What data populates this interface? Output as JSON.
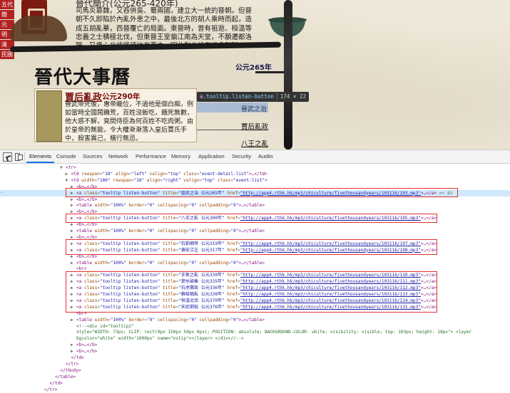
{
  "webpage": {
    "left_nav": [
      "五代",
      "簡",
      "元",
      "明",
      "清",
      "民國"
    ],
    "intro": {
      "title": "晉代簡介(公元265-420年)",
      "text": "司馬炎篡魏，又吞併吳、蜀兩國，建立大一統的晉朝。但晉朝不久即陷於內亂外患之中，最後北方的胡人乘時而起，造成五胡亂華，西晉覆亡的局面。東晉時，曾有祖逖、桓溫等忠義之士積極北伐，但東晉王室偏江南為天堂，不願遷都洛陽，又擔心北伐將領功高蓋主，因此對北伐者諸多掣肘。"
    },
    "section_title": "晉代大事曆",
    "year_marker": "公元265年",
    "event": {
      "title": "賈后亂政",
      "year": "公元290年",
      "description": "晉武帝死後，惠帝繼位，不過他是個白痴，例如當時全國鬧饑荒，百姓沒飯吃，餓死無數，他大惑不解，竟問侍臣為何百姓不吃肉粥。由於皇帝的無能，令大權漸漸落入皇后賈氏手中，殺害異己，橫行無忌。"
    },
    "tooltip_hint": {
      "tag": "a",
      "cls": ".tooltip.listen-button",
      "size": "174 × 22"
    },
    "links": [
      "晉武之治",
      "賈后亂政",
      "八王之亂"
    ]
  },
  "devtools": {
    "tabs": [
      "Elements",
      "Console",
      "Sources",
      "Network",
      "Performance",
      "Memory",
      "Application",
      "Security",
      "Audits"
    ],
    "active_tab": "Elements",
    "dom_rows": [
      {
        "indent": 0,
        "tri": "▼",
        "parts": [
          [
            "t",
            "<tr>"
          ]
        ]
      },
      {
        "indent": 1,
        "tri": "▶",
        "parts": [
          [
            "t",
            "<td "
          ],
          [
            "an",
            "rowspan"
          ],
          [
            "eq",
            "="
          ],
          [
            "av",
            "\"18\""
          ],
          [
            "an",
            " align"
          ],
          [
            "eq",
            "="
          ],
          [
            "av",
            "\"left\""
          ],
          [
            "an",
            " valign"
          ],
          [
            "eq",
            "="
          ],
          [
            "av",
            "\"top\""
          ],
          [
            "an",
            " class"
          ],
          [
            "eq",
            "="
          ],
          [
            "av",
            "\"event-detail-list\""
          ],
          [
            "t",
            ">…</td>"
          ]
        ]
      },
      {
        "indent": 1,
        "tri": "▼",
        "parts": [
          [
            "t",
            "<td "
          ],
          [
            "an",
            "width"
          ],
          [
            "eq",
            "="
          ],
          [
            "av",
            "\"180\""
          ],
          [
            "an",
            " rowspan"
          ],
          [
            "eq",
            "="
          ],
          [
            "av",
            "\"18\""
          ],
          [
            "an",
            " align"
          ],
          [
            "eq",
            "="
          ],
          [
            "av",
            "\"right\""
          ],
          [
            "an",
            " valign"
          ],
          [
            "eq",
            "="
          ],
          [
            "av",
            "\"top\""
          ],
          [
            "an",
            " class"
          ],
          [
            "eq",
            "="
          ],
          [
            "av",
            "\"event-list\""
          ],
          [
            "t",
            ">"
          ]
        ]
      },
      {
        "indent": 2,
        "tri": "▶",
        "parts": [
          [
            "t",
            "<b>…</b>"
          ]
        ]
      },
      {
        "indent": 2,
        "tri": "▶",
        "sel": true,
        "parts": [
          [
            "t",
            "<a "
          ],
          [
            "an",
            "class"
          ],
          [
            "eq",
            "="
          ],
          [
            "av",
            "\"tooltip listen-button\""
          ],
          [
            "an",
            " title"
          ],
          [
            "eq",
            "="
          ],
          [
            "av",
            "\"晉武之治 公元265年\""
          ],
          [
            "an",
            " href"
          ],
          [
            "eq",
            "="
          ],
          [
            "url",
            "\"http://app4.rthk.hk/mp3/chiculture/fivethousandyears/103116/103.mp3\""
          ],
          [
            "t",
            ">…</a>"
          ],
          [
            "eq",
            " == $0"
          ]
        ]
      },
      {
        "indent": 2,
        "tri": "▶",
        "parts": [
          [
            "t",
            "<b>…</b>"
          ]
        ]
      },
      {
        "indent": 2,
        "tri": "▶",
        "parts": [
          [
            "t",
            "<table "
          ],
          [
            "an",
            "width"
          ],
          [
            "eq",
            "="
          ],
          [
            "av",
            "\"100%\""
          ],
          [
            "an",
            " border"
          ],
          [
            "eq",
            "="
          ],
          [
            "av",
            "\"0\""
          ],
          [
            "an",
            " cellspacing"
          ],
          [
            "eq",
            "="
          ],
          [
            "av",
            "\"0\""
          ],
          [
            "an",
            " cellpadding"
          ],
          [
            "eq",
            "="
          ],
          [
            "av",
            "\"0\""
          ],
          [
            "t",
            ">…</table>"
          ]
        ]
      },
      {
        "indent": 2,
        "tri": "▶",
        "parts": [
          [
            "t",
            "<b>…</b>"
          ]
        ]
      },
      {
        "indent": 2,
        "tri": "▶",
        "parts": [
          [
            "t",
            "<a "
          ],
          [
            "an",
            "class"
          ],
          [
            "eq",
            "="
          ],
          [
            "av",
            "\"tooltip listen-button\""
          ],
          [
            "an",
            " title"
          ],
          [
            "eq",
            "="
          ],
          [
            "av",
            "\"八王之亂 公元300年\""
          ],
          [
            "an",
            " href"
          ],
          [
            "eq",
            "="
          ],
          [
            "url",
            "\"http://app4.rthk.hk/mp3/chiculture/fivethousandyears/103116/105.mp3\""
          ],
          [
            "t",
            ">…</a>"
          ]
        ]
      },
      {
        "indent": 2,
        "tri": "▶",
        "parts": [
          [
            "t",
            "<b>…</b>"
          ]
        ]
      },
      {
        "indent": 2,
        "tri": "▶",
        "parts": [
          [
            "t",
            "<table "
          ],
          [
            "an",
            "width"
          ],
          [
            "eq",
            "="
          ],
          [
            "av",
            "\"100%\""
          ],
          [
            "an",
            " border"
          ],
          [
            "eq",
            "="
          ],
          [
            "av",
            "\"0\""
          ],
          [
            "an",
            " cellspacing"
          ],
          [
            "eq",
            "="
          ],
          [
            "av",
            "\"0\""
          ],
          [
            "an",
            " cellpadding"
          ],
          [
            "eq",
            "="
          ],
          [
            "av",
            "\"0\""
          ],
          [
            "t",
            ">…</table>"
          ]
        ]
      },
      {
        "indent": 2,
        "tri": "▶",
        "parts": [
          [
            "t",
            "<b>…</b>"
          ]
        ]
      },
      {
        "indent": 2,
        "tri": "▶",
        "parts": [
          [
            "t",
            "<a "
          ],
          [
            "an",
            "class"
          ],
          [
            "eq",
            "="
          ],
          [
            "av",
            "\"tooltip listen-button\""
          ],
          [
            "an",
            " title"
          ],
          [
            "eq",
            "="
          ],
          [
            "av",
            "\"石勒稱帝 公元319年\""
          ],
          [
            "an",
            " href"
          ],
          [
            "eq",
            "="
          ],
          [
            "url",
            "\"http://app4.rthk.hk/mp3/chiculture/fivethousandyears/103116/107.mp3\""
          ],
          [
            "t",
            ">…</a>"
          ]
        ]
      },
      {
        "indent": 2,
        "tri": "▶",
        "parts": [
          [
            "t",
            "<a "
          ],
          [
            "an",
            "class"
          ],
          [
            "eq",
            "="
          ],
          [
            "av",
            "\"tooltip listen-button\""
          ],
          [
            "an",
            " title"
          ],
          [
            "eq",
            "="
          ],
          [
            "av",
            "\"偏安江左 公元317年\""
          ],
          [
            "an",
            " href"
          ],
          [
            "eq",
            "="
          ],
          [
            "url",
            "\"http://app4.rthk.hk/mp3/chiculture/fivethousandyears/103116/108.mp3\""
          ],
          [
            "t",
            ">…</a>"
          ]
        ]
      },
      {
        "indent": 2,
        "tri": "▶",
        "parts": [
          [
            "t",
            "<b>…</b>"
          ]
        ]
      },
      {
        "indent": 2,
        "tri": "▶",
        "parts": [
          [
            "t",
            "<table "
          ],
          [
            "an",
            "width"
          ],
          [
            "eq",
            "="
          ],
          [
            "av",
            "\"100%\""
          ],
          [
            "an",
            " border"
          ],
          [
            "eq",
            "="
          ],
          [
            "av",
            "\"0\""
          ],
          [
            "an",
            " cellspacing"
          ],
          [
            "eq",
            "="
          ],
          [
            "av",
            "\"0\""
          ],
          [
            "an",
            " cellpadding"
          ],
          [
            "eq",
            "="
          ],
          [
            "av",
            "\"0\""
          ],
          [
            "t",
            ">…</table>"
          ]
        ]
      },
      {
        "indent": 2,
        "tri": " ",
        "parts": [
          [
            "t",
            "<br>"
          ]
        ]
      },
      {
        "indent": 2,
        "tri": "▶",
        "parts": [
          [
            "t",
            "<a "
          ],
          [
            "an",
            "class"
          ],
          [
            "eq",
            "="
          ],
          [
            "av",
            "\"tooltip listen-button\""
          ],
          [
            "an",
            " title"
          ],
          [
            "eq",
            "="
          ],
          [
            "av",
            "\"王敦之亂 公元330年\""
          ],
          [
            "an",
            " href"
          ],
          [
            "eq",
            "="
          ],
          [
            "url",
            "\"http://app4.rthk.hk/mp3/chiculture/fivethousandyears/103116/110.mp3\""
          ],
          [
            "t",
            ">…</a>"
          ]
        ]
      },
      {
        "indent": 2,
        "tri": "▶",
        "parts": [
          [
            "t",
            "<a "
          ],
          [
            "an",
            "class"
          ],
          [
            "eq",
            "="
          ],
          [
            "av",
            "\"tooltip listen-button\""
          ],
          [
            "an",
            " title"
          ],
          [
            "eq",
            "="
          ],
          [
            "av",
            "\"淝水破秦 公元335年\""
          ],
          [
            "an",
            " href"
          ],
          [
            "eq",
            "="
          ],
          [
            "url",
            "\"http://app4.rthk.hk/mp3/chiculture/fivethousandyears/103116/111.mp3\""
          ],
          [
            "t",
            ">…</a>"
          ]
        ]
      },
      {
        "indent": 2,
        "tri": "▶",
        "parts": [
          [
            "t",
            "<a "
          ],
          [
            "an",
            "class"
          ],
          [
            "eq",
            "="
          ],
          [
            "av",
            "\"tooltip listen-button\""
          ],
          [
            "an",
            " title"
          ],
          [
            "eq",
            "="
          ],
          [
            "av",
            "\"石虎篡政 公元336年\""
          ],
          [
            "an",
            " href"
          ],
          [
            "eq",
            "="
          ],
          [
            "url",
            "\"http://app4.rthk.hk/mp3/chiculture/fivethousandyears/103116/112.mp3\""
          ],
          [
            "t",
            ">…</a>"
          ]
        ]
      },
      {
        "indent": 2,
        "tri": "▶",
        "parts": [
          [
            "t",
            "<a "
          ],
          [
            "an",
            "class"
          ],
          [
            "eq",
            "="
          ],
          [
            "av",
            "\"tooltip listen-button\""
          ],
          [
            "an",
            " title"
          ],
          [
            "eq",
            "="
          ],
          [
            "av",
            "\"蘇峻稱亂 公元338年\""
          ],
          [
            "an",
            " href"
          ],
          [
            "eq",
            "="
          ],
          [
            "url",
            "\"http://app4.rthk.hk/mp3/chiculture/fivethousandyears/103116/113.mp3\""
          ],
          [
            "t",
            ">…</a>"
          ]
        ]
      },
      {
        "indent": 2,
        "tri": "▶",
        "parts": [
          [
            "t",
            "<a "
          ],
          [
            "an",
            "class"
          ],
          [
            "eq",
            "="
          ],
          [
            "av",
            "\"tooltip listen-button\""
          ],
          [
            "an",
            " title"
          ],
          [
            "eq",
            "="
          ],
          [
            "av",
            "\"桓溫北伐 公元370年\""
          ],
          [
            "an",
            " href"
          ],
          [
            "eq",
            "="
          ],
          [
            "url",
            "\"http://app4.rthk.hk/mp3/chiculture/fivethousandyears/103116/114.mp3\""
          ],
          [
            "t",
            ">…</a>"
          ]
        ]
      },
      {
        "indent": 2,
        "tri": "▶",
        "parts": [
          [
            "t",
            "<a "
          ],
          [
            "an",
            "class"
          ],
          [
            "eq",
            "="
          ],
          [
            "av",
            "\"tooltip listen-button\""
          ],
          [
            "an",
            " title"
          ],
          [
            "eq",
            "="
          ],
          [
            "av",
            "\"宋武劉裕 公元376年\""
          ],
          [
            "an",
            " href"
          ],
          [
            "eq",
            "="
          ],
          [
            "url",
            "\"http://app4.rthk.hk/mp3/chiculture/fivethousandyears/103116/115.mp3\""
          ],
          [
            "t",
            ">…</a>"
          ]
        ]
      },
      {
        "indent": 2,
        "tri": " ",
        "parts": [
          [
            "t",
            "<br>"
          ]
        ]
      },
      {
        "indent": 2,
        "tri": "▶",
        "parts": [
          [
            "t",
            "<table "
          ],
          [
            "an",
            "width"
          ],
          [
            "eq",
            "="
          ],
          [
            "av",
            "\"100%\""
          ],
          [
            "an",
            " border"
          ],
          [
            "eq",
            "="
          ],
          [
            "av",
            "\"0\""
          ],
          [
            "an",
            " cellspacing"
          ],
          [
            "eq",
            "="
          ],
          [
            "av",
            "\"0\""
          ],
          [
            "an",
            " cellpadding"
          ],
          [
            "eq",
            "="
          ],
          [
            "av",
            "\"0\""
          ],
          [
            "t",
            ">…</table>"
          ]
        ]
      },
      {
        "indent": 2,
        "tri": " ",
        "parts": [
          [
            "cm",
            "<!--<div id=\"tooltip2\""
          ]
        ]
      },
      {
        "indent": 2,
        "tri": " ",
        "parts": [
          [
            "cm",
            "style=\"WIDTH: 73px; CLIP: rect(0px 150px 50px 0px); POSITION: absolute; BACKGROUND-COLOR: white; visibility: visible; top: 103px; height: 18px\"> <layer"
          ]
        ]
      },
      {
        "indent": 2,
        "tri": " ",
        "parts": [
          [
            "cm",
            "bgcolor=\"white\" width=\"1000px\" name=\"nstip\"></layer> </div>//-->"
          ]
        ]
      },
      {
        "indent": 2,
        "tri": "▶",
        "parts": [
          [
            "t",
            "<b>…</b>"
          ]
        ]
      },
      {
        "indent": 2,
        "tri": "▶",
        "parts": [
          [
            "t",
            "<b>…</b>"
          ]
        ]
      },
      {
        "indent": 1,
        "tri": " ",
        "parts": [
          [
            "t",
            "</td>"
          ]
        ]
      },
      {
        "indent": 0,
        "tri": " ",
        "parts": [
          [
            "t",
            "</tr>"
          ]
        ]
      },
      {
        "indent": -1,
        "tri": " ",
        "parts": [
          [
            "t",
            "</tbody>"
          ]
        ]
      },
      {
        "indent": -2,
        "tri": " ",
        "parts": [
          [
            "t",
            "</table>"
          ]
        ]
      },
      {
        "indent": -3,
        "tri": " ",
        "parts": [
          [
            "t",
            "</td>"
          ]
        ]
      },
      {
        "indent": -4,
        "tri": " ",
        "parts": [
          [
            "t",
            "</tr>"
          ]
        ]
      }
    ]
  }
}
